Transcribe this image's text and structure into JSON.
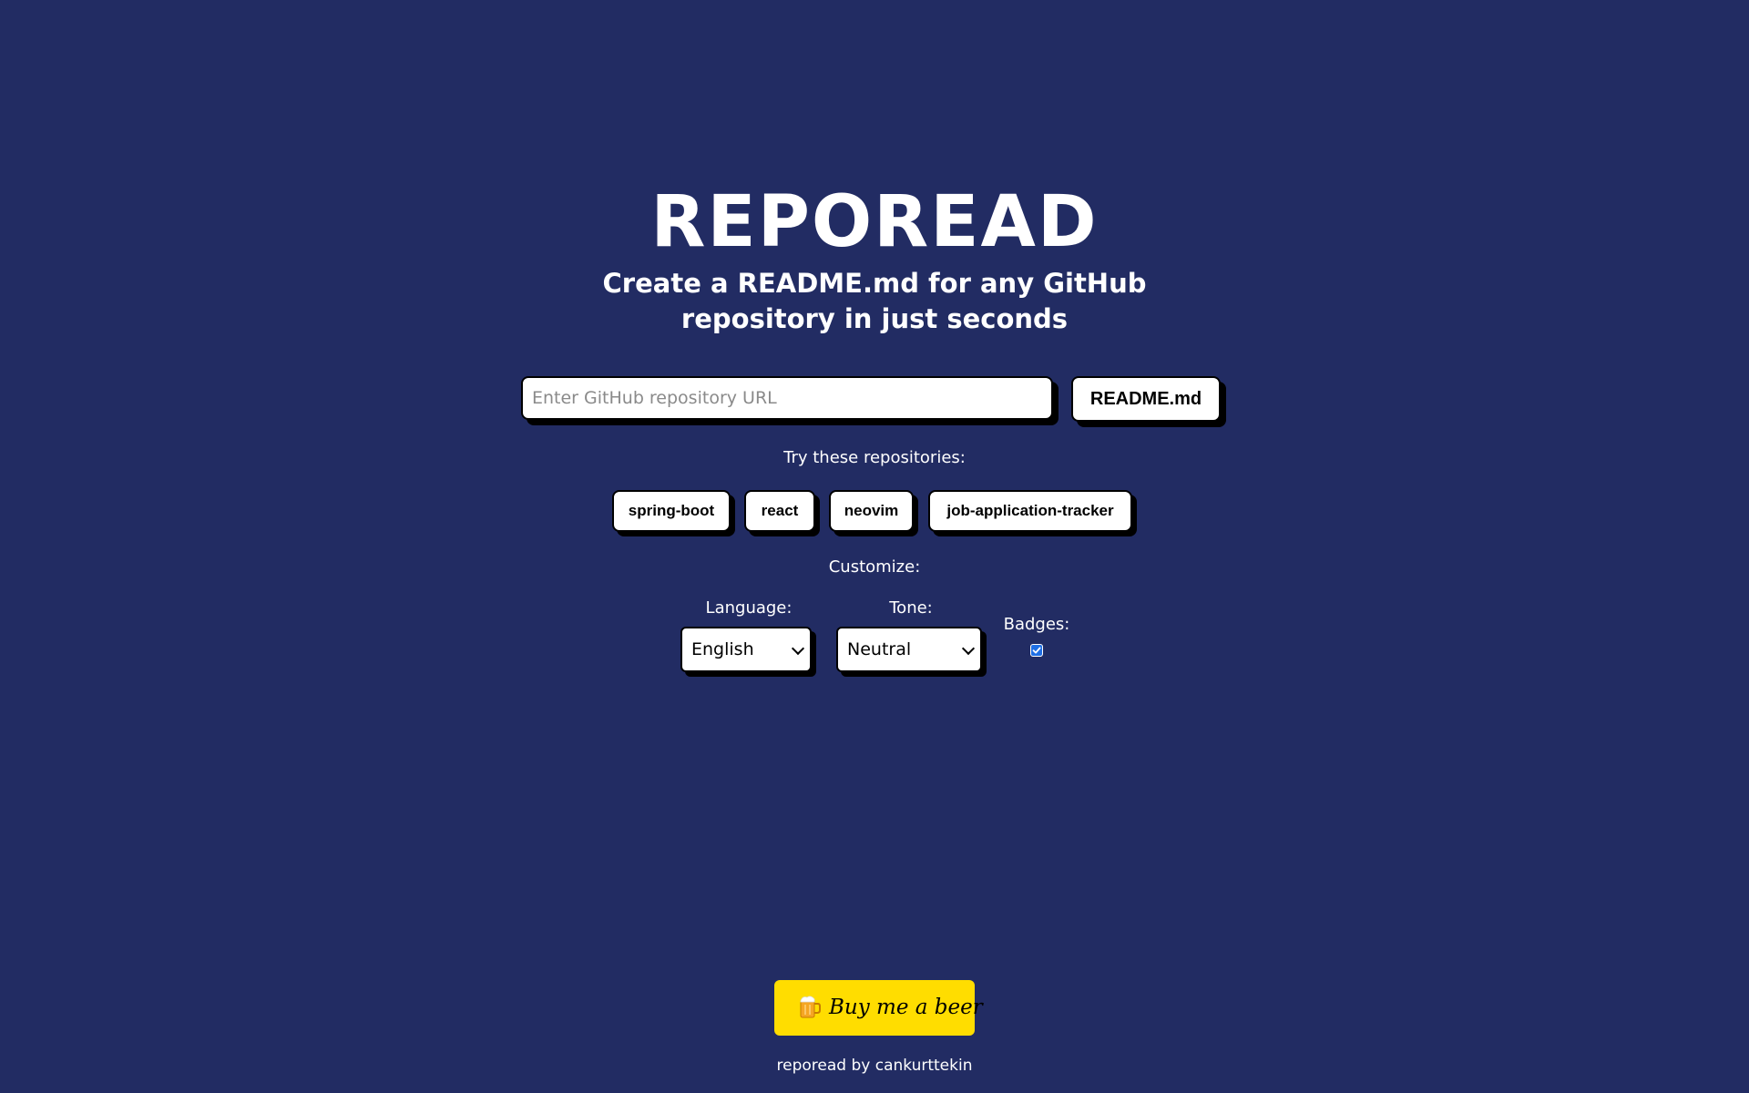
{
  "header": {
    "title": "REPOREAD",
    "subtitle": "Create a README.md for any GitHub repository in just seconds"
  },
  "search": {
    "placeholder": "Enter GitHub repository URL",
    "value": "",
    "button_label": "README.md"
  },
  "suggestions": {
    "label": "Try these repositories:",
    "repos": [
      "spring-boot",
      "react",
      "neovim",
      "job-application-tracker"
    ]
  },
  "customize": {
    "label": "Customize:",
    "language": {
      "label": "Language:",
      "selected": "English"
    },
    "tone": {
      "label": "Tone:",
      "selected": "Neutral"
    },
    "badges": {
      "label": "Badges:",
      "checked": true
    }
  },
  "support": {
    "button_label": "Buy me a beer",
    "icon": "beer-mug-icon"
  },
  "footer": {
    "text": "reporead by cankurttekin"
  },
  "colors": {
    "background": "#222c63",
    "accent_yellow": "#ffdd00",
    "checkbox_blue": "#1f6fe5"
  }
}
